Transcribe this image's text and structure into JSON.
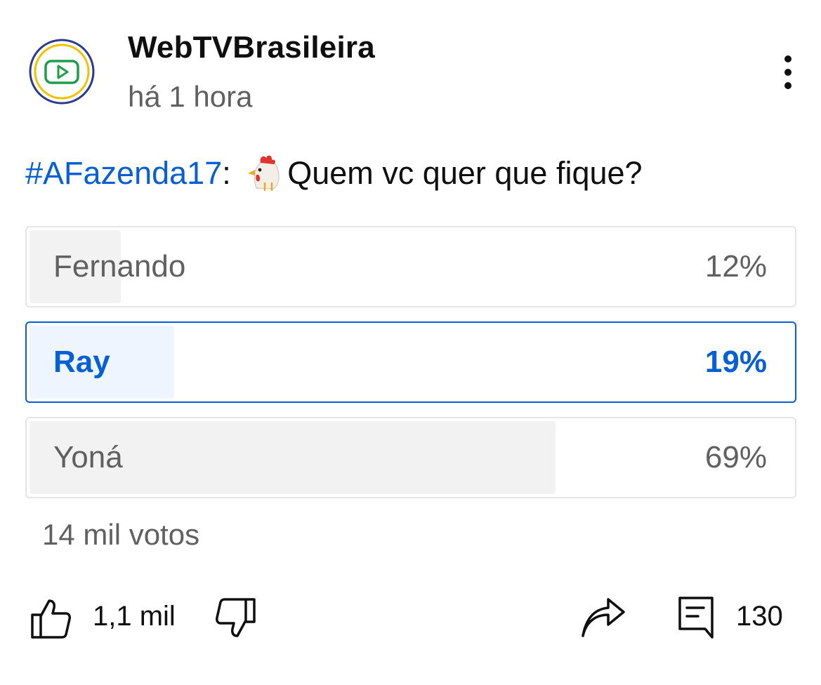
{
  "channel": {
    "name": "WebTVBrasileira",
    "time": "há 1 hora",
    "avatar_icon": "play-logo-icon"
  },
  "post": {
    "hashtag": "#AFazenda17",
    "separator": ":",
    "emoji": "chicken-emoji",
    "text": "Quem vc quer que fique?"
  },
  "poll": {
    "options": [
      {
        "label": "Fernando",
        "percent_text": "12%",
        "percent": 12,
        "selected": false
      },
      {
        "label": "Ray",
        "percent_text": "19%",
        "percent": 19,
        "selected": true
      },
      {
        "label": "Yoná",
        "percent_text": "69%",
        "percent": 69,
        "selected": false
      }
    ],
    "votes": "14 mil votos"
  },
  "actions": {
    "like_count": "1,1 mil",
    "comment_count": "130"
  },
  "colors": {
    "accent": "#065fd4",
    "secondary_text": "#606060",
    "bar_fill": "#f2f2f2"
  }
}
